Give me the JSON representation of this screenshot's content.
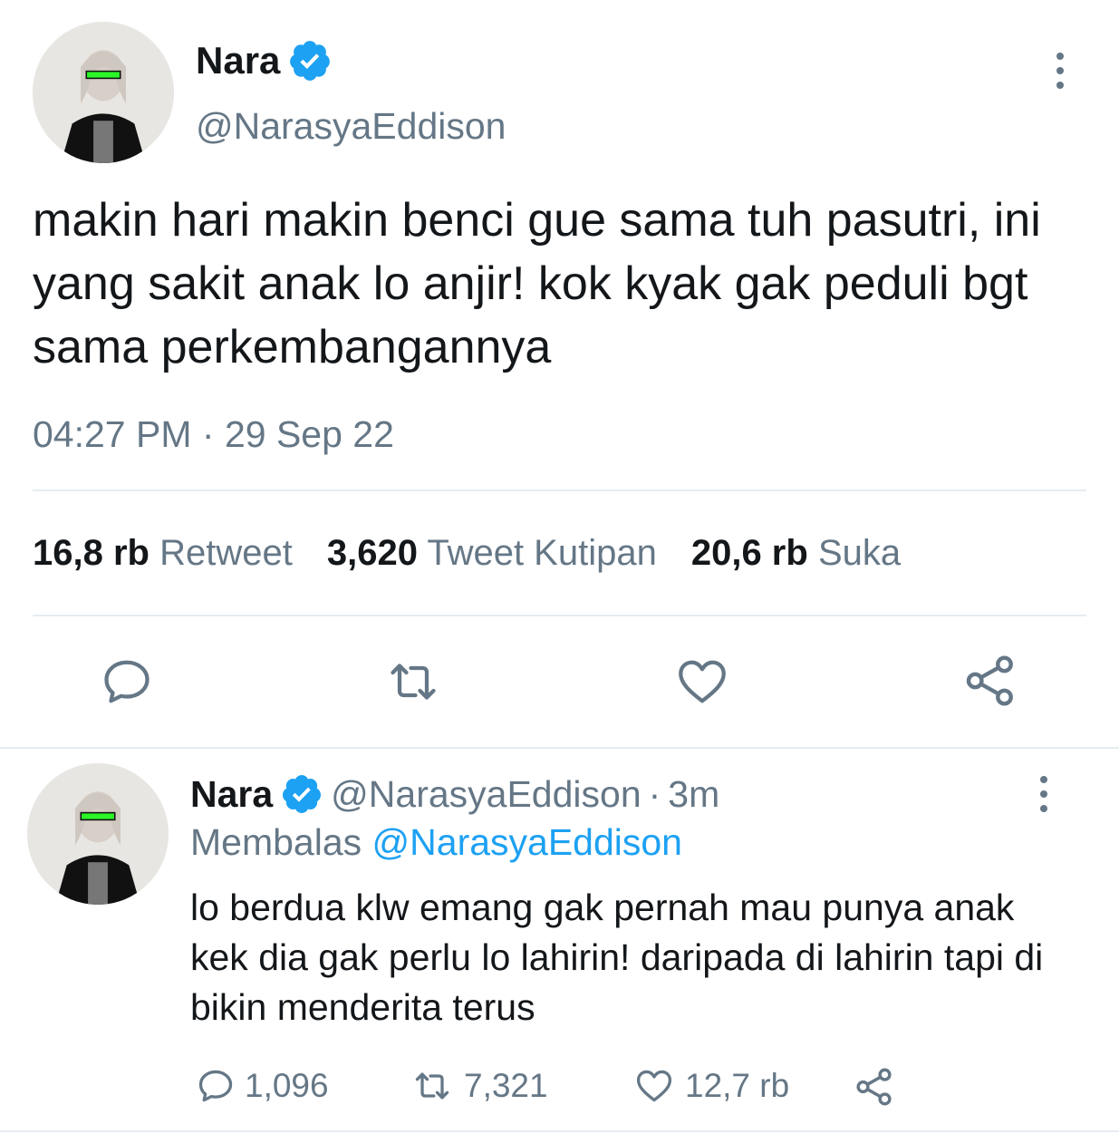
{
  "main_tweet": {
    "display_name": "Nara",
    "handle": "@NarasyaEddison",
    "text": "makin hari makin benci gue sama tuh pasutri, ini yang sakit anak lo anjir! kok kyak gak peduli bgt sama perkembangannya",
    "time": "04:27 PM",
    "separator": "·",
    "date": "29 Sep 22",
    "stats": [
      {
        "count": "16,8 rb",
        "label": "Retweet"
      },
      {
        "count": "3,620",
        "label": "Tweet Kutipan"
      },
      {
        "count": "20,6 rb",
        "label": "Suka"
      }
    ],
    "actions": [
      "reply-icon",
      "retweet-icon",
      "like-icon",
      "share-icon"
    ]
  },
  "reply_tweet": {
    "display_name": "Nara",
    "handle": "@NarasyaEddison",
    "dot": "·",
    "age": "3m",
    "replying_label": "Membalas",
    "replying_to": "@NarasyaEddison",
    "text": "lo berdua klw emang gak pernah mau punya anak kek dia gak perlu lo lahirin! daripada di lahirin tapi di bikin menderita terus",
    "reply_count": "1,096",
    "retweet_count": "7,321",
    "like_count": "12,7 rb"
  },
  "colors": {
    "verified": "#1da1f2",
    "secondary_text": "#657786",
    "link": "#1da1f2"
  }
}
